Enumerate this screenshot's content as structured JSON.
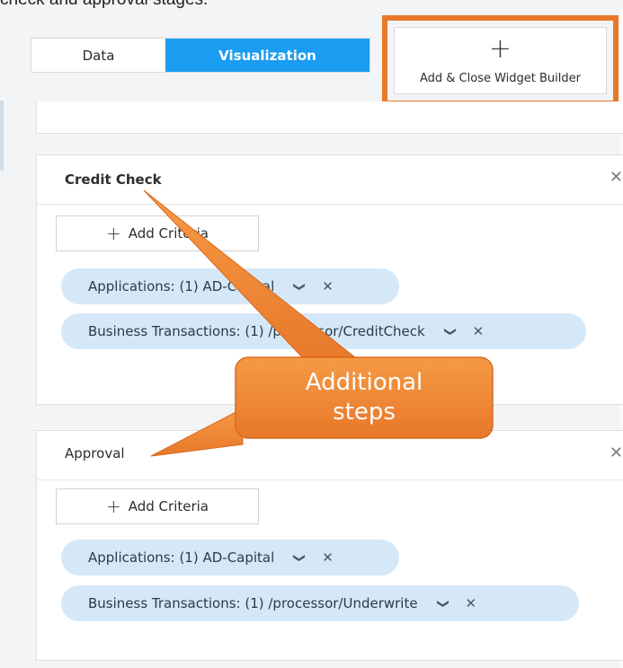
{
  "caption": "check and approval stages.",
  "tabs": [
    {
      "label": "Data",
      "active": false
    },
    {
      "label": "Visualization",
      "active": true
    }
  ],
  "add_close_button": {
    "icon": "plus-icon",
    "label": "Add & Close Widget Builder"
  },
  "steps": [
    {
      "title": "Credit Check",
      "add_criteria_label": "Add Criteria",
      "filters": [
        "Applications: (1) AD-Capital",
        "Business Transactions: (1) /processor/CreditCheck"
      ]
    },
    {
      "title": "Approval",
      "add_criteria_label": "Add Criteria",
      "filters": [
        "Applications: (1) AD-Capital",
        "Business Transactions: (1) /processor/Underwrite"
      ]
    }
  ],
  "callout": {
    "line1": "Additional",
    "line2": "steps"
  },
  "colors": {
    "accent": "#1a9cf0",
    "highlight": "#e8782a",
    "callout": "#f0872f",
    "pill": "#d5e8f8"
  }
}
